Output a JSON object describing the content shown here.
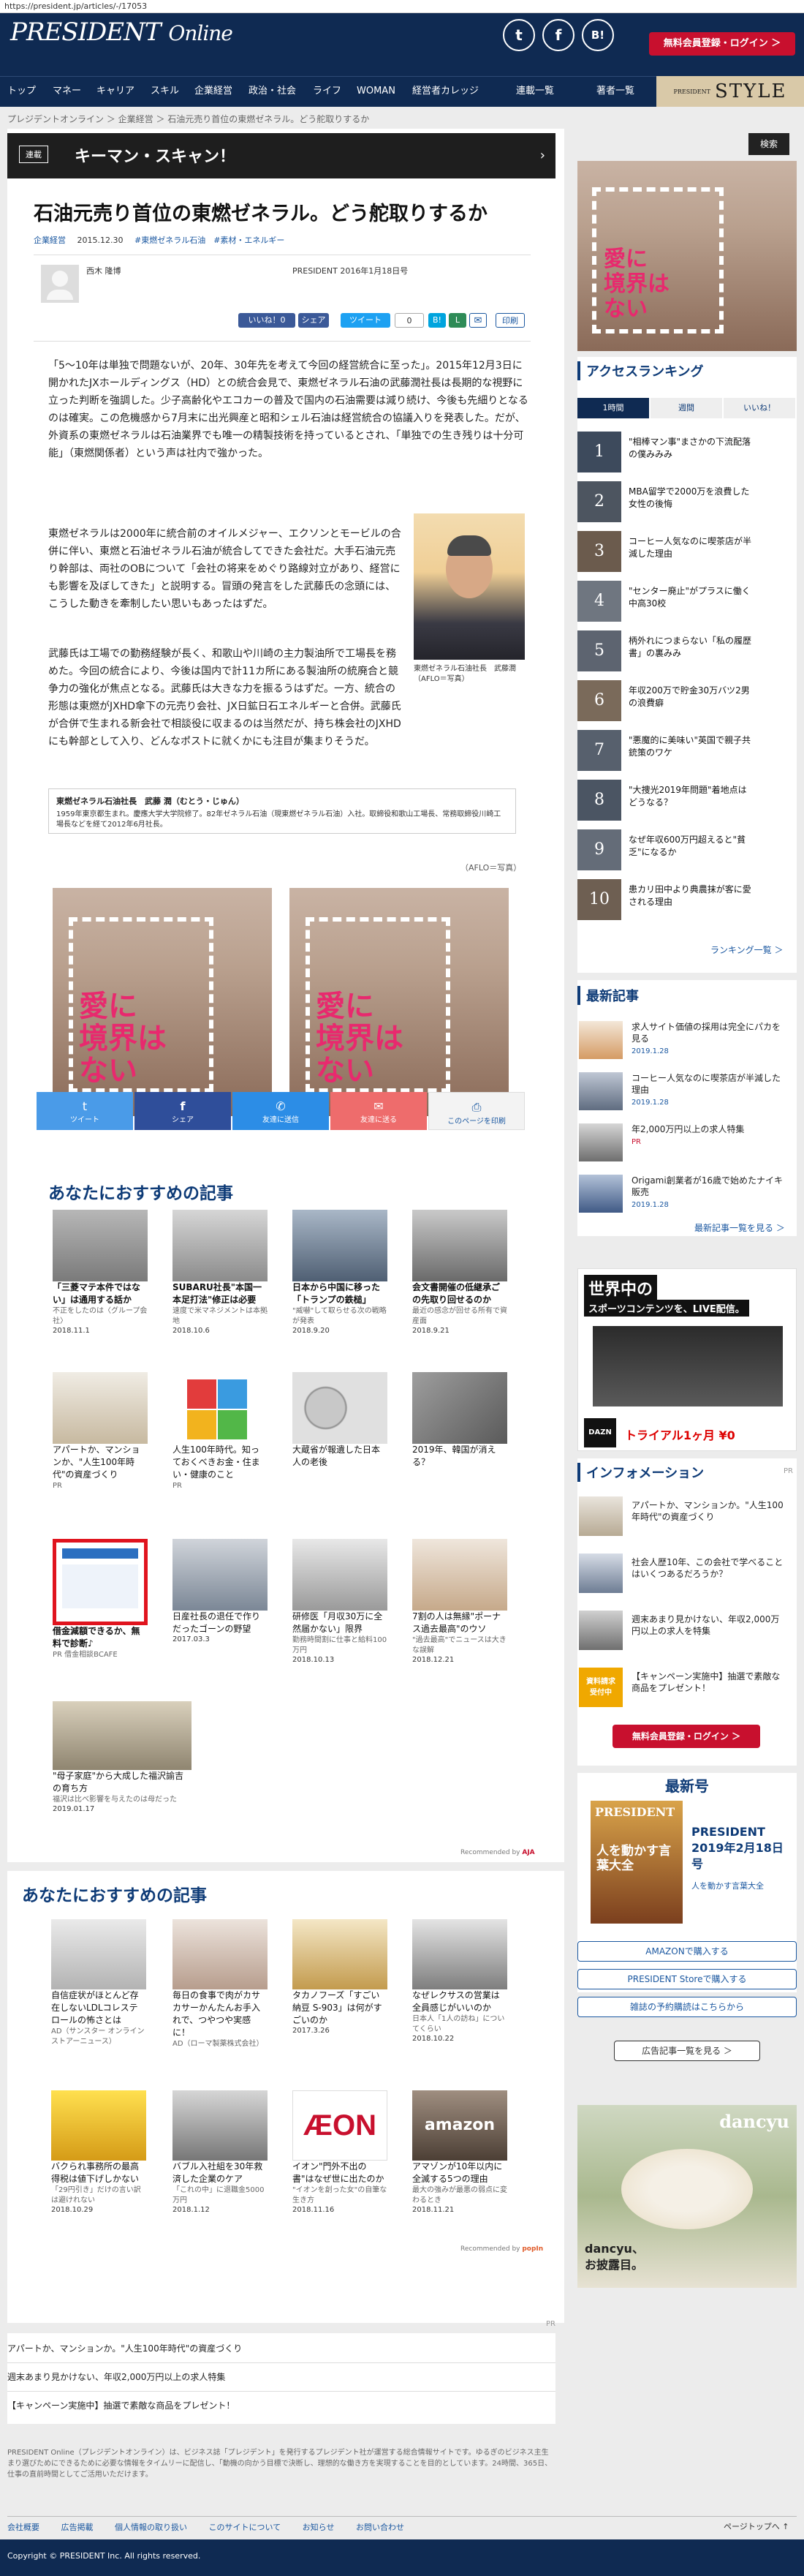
{
  "url": "https://president.jp/articles/-/17053",
  "header": {
    "logo_main": "PRESIDENT",
    "logo_sub": "Online",
    "social": [
      "t",
      "f",
      "B!"
    ],
    "register_label": "無料会員登録・ログイン ＞"
  },
  "nav": {
    "items": [
      "トップ",
      "マネー",
      "キャリア",
      "スキル",
      "企業経営",
      "政治・社会",
      "ライフ",
      "WOMAN",
      "経営者カレッジ"
    ],
    "serial": "連載一覧",
    "authors": "著者一覧",
    "style_small": "PRESIDENT",
    "style": "STYLE"
  },
  "breadcrumb": "プレジデントオンライン ＞ 企業経営 ＞ 石油元売り首位の東燃ゼネラル。どう舵取りするか",
  "article": {
    "serial_tag": "連載",
    "serial_title": "キーマン・スキャン！",
    "title": "石油元売り首位の東燃ゼネラル。どう舵取りするか",
    "category": "企業経営",
    "date": "2015.12.30",
    "tags": "#東燃ゼネラル石油　#素材・エネルギー",
    "author": "西木 隆博",
    "source": "PRESIDENT 2016年1月18日号",
    "share": {
      "like": "いいね！0",
      "share": "シェア",
      "tweet": "ツイート",
      "count": "0",
      "B": "B!",
      "mail": "✉",
      "print": "印刷"
    },
    "lead": "「5〜10年は単独で問題ないが、20年、30年先を考えて今回の経営統合に至った」。2015年12月3日に開かれたJXホールディングス（HD）との統合会見で、東燃ゼネラル石油の武藤潤社長は長期的な視野に立った判断を強調した。少子高齢化やエコカーの普及で国内の石油需要は減り続け、今後も先細りとなるのは確実。この危機感から7月末に出光興産と昭和シェル石油は経営統合の協議入りを発表した。だが、外資系の東燃ゼネラルは石油業界でも唯一の精製技術を持っているとされ、「単独での生き残りは十分可能」（東燃関係者）という声は社内で強かった。",
    "p2": "東燃ゼネラルは2000年に統合前のオイルメジャー、エクソンとモービルの合併に伴い、東燃と石油ゼネラル石油が統合してできた会社だ。大手石油元売り幹部は、両社のOBについて「会社の将来をめぐり路線対立があり、経営にも影響を及ぼしてきた」と説明する。冒頭の発言をした武藤氏の念頭には、こうした動きを牽制したい思いもあったはずだ。",
    "p3": "武藤氏は工場での勤務経験が長く、和歌山や川崎の主力製油所で工場長を務めた。今回の統合により、今後は国内で計11カ所にある製油所の統廃合と競争力の強化が焦点となる。武藤氏は大きな力を振るうはずだ。一方、統合の形態は東燃がJXHD傘下の元売り会社、JX日鉱日石エネルギーと合併。武藤氏が合併で生まれる新会社で相談役に収まるのは当然だが、持ち株会社のJXHDにも幹部として入り、どんなポストに就くかにも注目が集まりそうだ。",
    "photo_caption": "東燃ゼネラル石油社長　武藤潤（AFLO＝写真）",
    "profile_name": "東燃ゼネラル石油社長　武藤 潤（むとう・じゅん）",
    "profile_text": "1959年東京都生まれ。慶應大学大学院修了。82年ゼネラル石油（現東燃ゼネラル石油）入社。取締役和歌山工場長、常務取締役川崎工場長などを経て2012年6月社長。",
    "credit": "（AFLO＝写真）"
  },
  "ad_text": "愛に\n境界は\nない",
  "share_bar": [
    {
      "icon": "twitter-icon",
      "label": "ツイート",
      "color": "#4a9be8"
    },
    {
      "icon": "facebook-icon",
      "label": "シェア",
      "color": "#2f4e9a"
    },
    {
      "icon": "messenger-icon",
      "label": "友達に送信",
      "color": "#2c8de6"
    },
    {
      "icon": "mail-icon",
      "label": "友達に送る",
      "color": "#ee6c6c"
    },
    {
      "icon": "print-icon",
      "label": "このページを印刷",
      "color": "#f3f3f3"
    }
  ],
  "rec1": {
    "heading": "あなたにおすすめの記事",
    "items": [
      {
        "title": "「三菱マテ本件ではない」は通用する話か",
        "sub": "不正をしたのは〈グループ会社〉",
        "date": "2018.11.1"
      },
      {
        "title": "SUBARU社長\"本国一本足打法\"修正は必要",
        "sub": "速度で米マネジメントは本拠地",
        "date": "2018.10.6"
      },
      {
        "title": "日本から中国に移った「トランプの鉄槌」",
        "sub": "\"威嚇\"して取らせる次の戦略が発表",
        "date": "2018.9.20"
      },
      {
        "title": "会文書開催の低継承ごの先取り回せるのか",
        "sub": "最近の感念が回せる所有で資産面",
        "date": "2018.9.21"
      },
      {
        "title": "アパートか、マンションか、\"人生100年時代\"の資産づくり",
        "sub": "PR",
        "date": ""
      },
      {
        "title": "人生100年時代。知っておくべきお金・住まい・健康のこと",
        "sub": "PR",
        "date": ""
      },
      {
        "title": "大蔵省が報遺した日本人の老後",
        "sub": "",
        "date": ""
      },
      {
        "title": "2019年、韓国が消える？",
        "sub": "",
        "date": ""
      },
      {
        "title": "借金減額できるか、無料で診断♪",
        "sub": "PR 借金相談BCAFE",
        "date": ""
      },
      {
        "title": "日産社長の退任で作りだったゴーンの野望",
        "sub": "",
        "date": "2017.03.3"
      },
      {
        "title": "研修医「月収30万に全然届かない」限界",
        "sub": "勤務時間割に仕事と給料100万円",
        "date": "2018.10.13"
      },
      {
        "title": "7割の人は無縁\"ポーナス過去最高\"のウソ",
        "sub": "\"過去最高\"でニュースは大きな誤解",
        "date": "2018.12.21"
      },
      {
        "title": "\"母子家庭\"から大成した福沢諭吉の育ち方",
        "sub": "福沢は比べ影響を与えたのは母だった",
        "date": "2019.01.17"
      }
    ],
    "recommended_by": "Recommended by"
  },
  "rec2": {
    "heading": "あなたにおすすめの記事",
    "items": [
      {
        "title": "自信症状がほとんど存在しないLDLコレステロールの怖さとは",
        "sub": "AD（サンスター オンラインストアーニュース）",
        "date": ""
      },
      {
        "title": "毎日の食事で肉がカサカサーかんたんお手入れで、つやつや実感に！",
        "sub": "AD（ローマ製薬株式会社）",
        "date": ""
      },
      {
        "title": "タカノフーズ「すごい納豆 S-903」は何がすごいのか",
        "sub": "",
        "date": "2017.3.26"
      },
      {
        "title": "なぜレクサスの営業は全員感じがいいのか",
        "sub": "日本人「1人の訪ね」についてくらい",
        "date": "2018.10.22"
      },
      {
        "title": "バクられ事務所の最高得税は値下げしかない",
        "sub": "「29円引き」だけの言い訳は避けれない",
        "date": "2018.10.29"
      },
      {
        "title": "バブル入社組を30年救済した企業のケア",
        "sub": "「これの中」に退職金5000万円",
        "date": "2018.1.12"
      },
      {
        "title": "イオン\"門外不出の書\"はなぜ世に出たのか",
        "sub": "\"イオンを創った女\"の自筆な生き方",
        "date": "2018.11.16"
      },
      {
        "title": "アマゾンが10年以内に全滅する5つの理由",
        "sub": "最大の強みが最悪の弱点に変わるとき",
        "date": "2018.11.21"
      }
    ],
    "recommended_by": "Recommended by"
  },
  "pr_links": [
    "アパートか、マンションか。\"人生100年時代\"の資産づくり",
    "週末あまり見かけない、年収2,000万円以上の求人特集",
    "【キャンペーン実施中】抽選で素敵な商品をプレゼント！"
  ],
  "footer_note": "PRESIDENT Online（プレジデントオンライン）は、ビジネス誌「プレジデント」を発行するプレジデント社が運営する総合情報サイトです。ゆるぎのビジネス主生まり選びためにできるために必要な情報をタイムリーに配信し、「動機の向かう目標で決断し、理想的な働き方を実現することを目的としています。24時間、365日、仕事の直前時間としてご活用いただけます。",
  "footer_links": [
    "会社概要",
    "広告掲載",
    "個人情報の取り扱い",
    "このサイトについて",
    "お知らせ",
    "お問い合わせ"
  ],
  "page_top": "ページトップへ ↑",
  "copyright": "Copyright © PRESIDENT Inc. All rights reserved.",
  "sidebar": {
    "search": "検索",
    "ranking_heading": "アクセスランキング",
    "tabs": [
      "1時間",
      "週間",
      "いいね！"
    ],
    "ranking": [
      "\"相棒マン事\"まさかの下流配落の僕みみみ",
      "MBA留学で2000万を浪費した女性の後悔",
      "コーヒー人気なのに喫茶店が半減した理由",
      "\"センター廃止\"がプラスに働く中高30校",
      "柄外れにつまらない「私の履歴書」の裏みみ",
      "年収200万で貯金30万バツ2男の浪費癖",
      "\"悪魔的に美味い\"英国で親子共銃策のワケ",
      "\"大捜光2019年問題\"着地点はどうなる？",
      "なぜ年収600万円超えると\"貧乏\"になるか",
      "患カリ田中より典農抹が客に愛される理由"
    ],
    "ranking_more": "ランキング一覧 ＞",
    "latest_heading": "最新記事",
    "latest": [
      {
        "title": "求人サイト価値の採用は完全にパカを見る",
        "date": "2019.1.28"
      },
      {
        "title": "コーヒー人気なのに喫茶店が半減した理由",
        "date": "2019.1.28"
      },
      {
        "title": "年2,000万円以上の求人特集",
        "date": "PR"
      },
      {
        "title": "Origami創業者が16歳で始めたナイキ販売",
        "date": "2019.1.28"
      }
    ],
    "latest_more": "最新記事一覧を見る ＞",
    "ad_head": "世界中の",
    "ad_head2": "スポーツコンテンツを、LIVE配信。",
    "ad_price": "トライアル1ヶ月 ¥0",
    "ad_brand": "DAZN",
    "info_heading": "インフォメーション",
    "info": [
      "アパートか、マンションか。\"人生100年時代\"の資産づくり",
      "社会人歴10年、この会社で学べることはいくつあるだろうか？",
      "週末あまり見かけない、年収2,000万円以上の求人を特集",
      "【キャンペーン実施中】抽選で素敵な商品をプレゼント！"
    ],
    "register_label": "無料会員登録・ログイン ＞",
    "issue_heading": "最新号",
    "issue_title": "PRESIDENT 2019年2月18日号",
    "issue_sub": "人を動かす言葉大全",
    "cover_logo": "PRESIDENT",
    "cover_text": "人を動かす言葉大全",
    "buy": [
      "AMAZONで購入する",
      "PRESIDENT Storeで購入する",
      "雑誌の予約購読はこちらから"
    ],
    "back_issues": "広告記事一覧を見る ＞",
    "dancyu": "dancyu",
    "dancyu_text": "dancyu、\nお披露目。"
  }
}
